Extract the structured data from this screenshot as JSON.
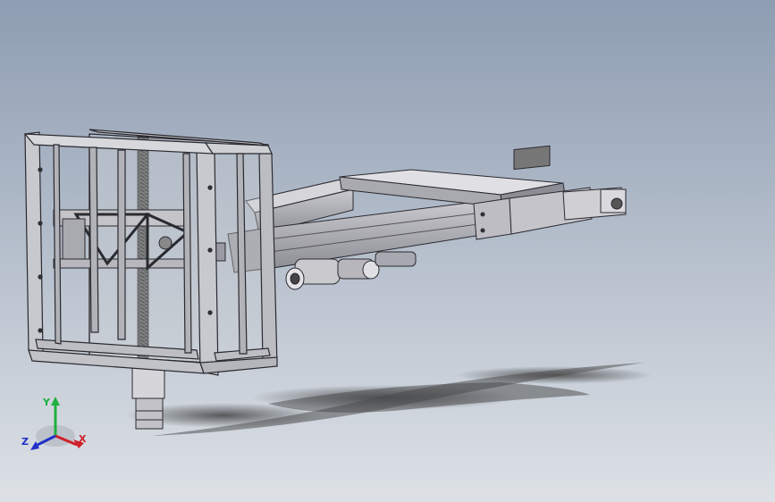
{
  "viewport": {
    "background_top": "#8e9db2",
    "background_bottom": "#dde1e6"
  },
  "model": {
    "frame_color": "#b4b6bc",
    "edge_color": "#2a2a30",
    "lead_screw_color": "#3a3a3a",
    "motor_color": "#c8c8cc"
  },
  "triad": {
    "x_label": "X",
    "y_label": "Y",
    "z_label": "Z",
    "x_color": "#d0202a",
    "y_color": "#20b040",
    "z_color": "#2030c8"
  }
}
